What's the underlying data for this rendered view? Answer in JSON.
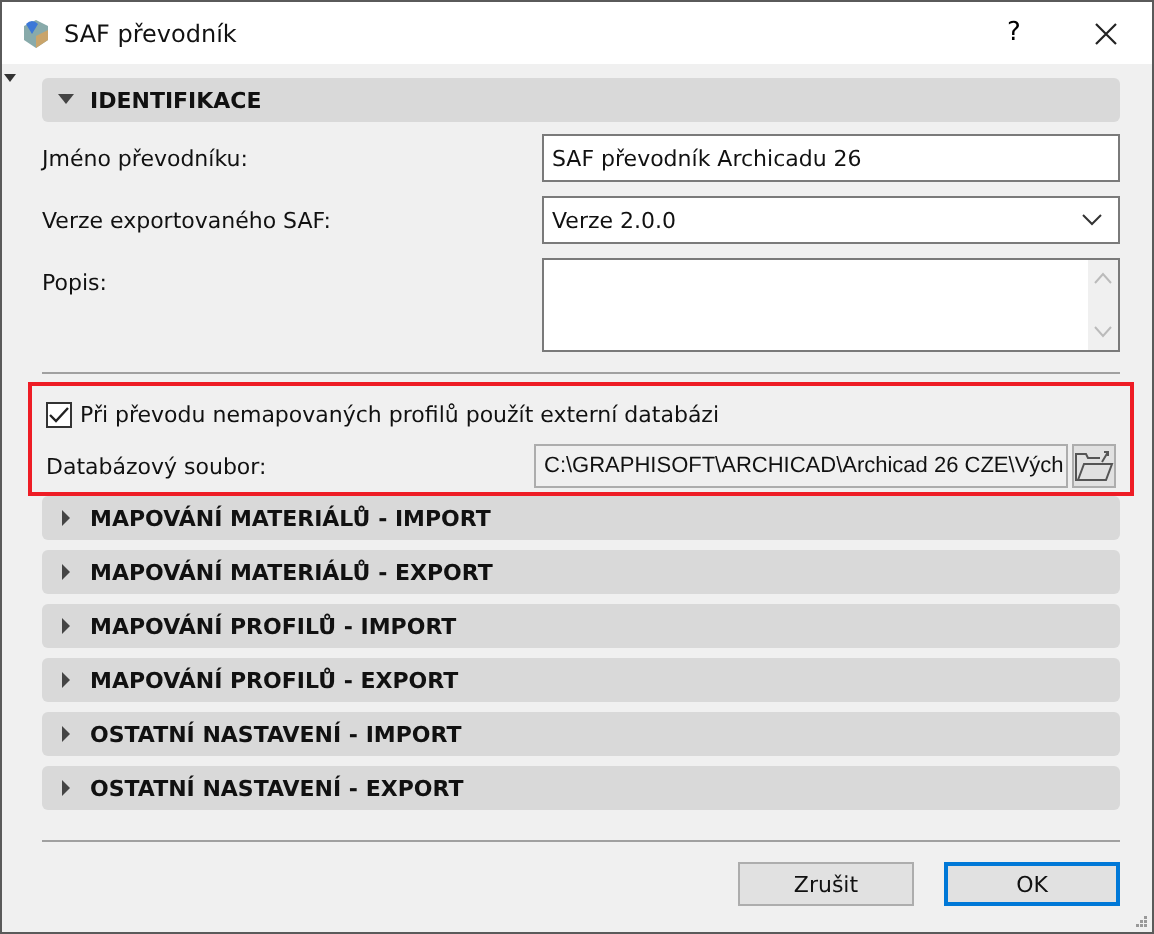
{
  "window": {
    "title": "SAF převodník",
    "help": "?"
  },
  "sections": [
    {
      "title": "IDENTIFIKACE",
      "expanded": true,
      "fields": [
        {
          "kind": "text",
          "label": "Jméno převodníku:",
          "value": "SAF převodník Archicadu 26"
        },
        {
          "kind": "select",
          "label": "Verze exportovaného SAF:",
          "value": "Verze 2.0.0"
        },
        {
          "kind": "textarea",
          "label": "Popis:"
        }
      ]
    }
  ],
  "external_database": {
    "highlighted": true,
    "checkbox": {
      "label": "Při převodu nemapovaných profilů použít externí databázi",
      "checked": true
    },
    "file": {
      "label": "Databázový soubor:",
      "value": "C:\\GRAPHISOFT\\ARCHICAD\\Archicad 26 CZE\\Vých"
    }
  },
  "collapsed_sections": [
    {
      "title": "MAPOVÁNÍ MATERIÁLŮ - IMPORT",
      "expanded": false
    },
    {
      "title": "MAPOVÁNÍ MATERIÁLŮ - EXPORT",
      "expanded": false
    },
    {
      "title": "MAPOVÁNÍ PROFILŮ - IMPORT",
      "expanded": false
    },
    {
      "title": "MAPOVÁNÍ PROFILŮ - EXPORT",
      "expanded": false
    },
    {
      "title": "OSTATNÍ NASTAVENÍ - IMPORT",
      "expanded": false
    },
    {
      "title": "OSTATNÍ NASTAVENÍ - EXPORT",
      "expanded": false
    }
  ],
  "buttons": [
    {
      "label": "Zrušit",
      "default": false
    },
    {
      "label": "OK",
      "default": true
    }
  ]
}
